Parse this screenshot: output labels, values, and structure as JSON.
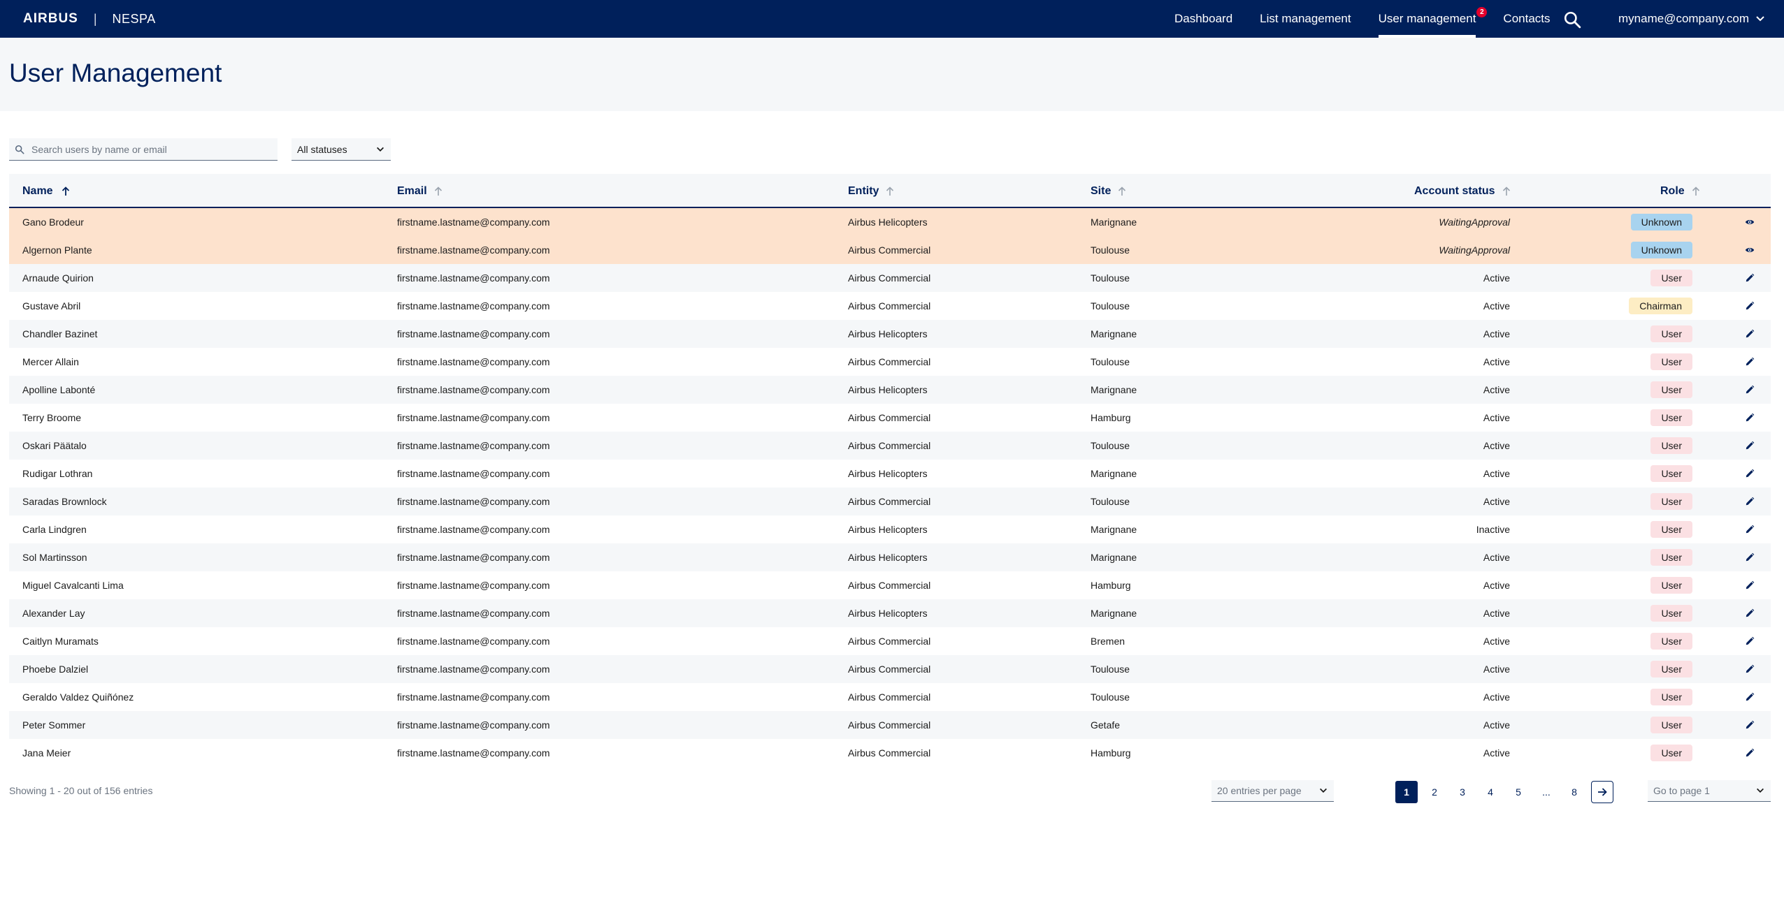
{
  "brand": {
    "logo": "AIRBUS",
    "separator": "|",
    "app_name": "NESPA"
  },
  "nav": {
    "items": [
      {
        "label": "Dashboard",
        "active": false
      },
      {
        "label": "List management",
        "active": false
      },
      {
        "label": "User management",
        "active": true,
        "badge": "2"
      },
      {
        "label": "Contacts",
        "active": false
      }
    ],
    "search_icon": "search-icon",
    "user_email": "myname@company.com"
  },
  "page": {
    "title": "User Management"
  },
  "filters": {
    "search_placeholder": "Search users by name or email",
    "status_value": "All statuses"
  },
  "table": {
    "columns": [
      "Name",
      "Email",
      "Entity",
      "Site",
      "Account status",
      "Role"
    ],
    "rows": [
      {
        "name": "Gano Brodeur",
        "email": "firstname.lastname@company.com",
        "entity": "Airbus Helicopters",
        "site": "Marignane",
        "status": "WaitingApproval",
        "role": "Unknown",
        "action": "eye-icon"
      },
      {
        "name": "Algernon Plante",
        "email": "firstname.lastname@company.com",
        "entity": "Airbus Commercial",
        "site": "Toulouse",
        "status": "WaitingApproval",
        "role": "Unknown",
        "action": "eye-icon"
      },
      {
        "name": "Arnaude Quirion",
        "email": "firstname.lastname@company.com",
        "entity": "Airbus Commercial",
        "site": "Toulouse",
        "status": "Active",
        "role": "User",
        "action": "pencil-icon"
      },
      {
        "name": "Gustave Abril",
        "email": "firstname.lastname@company.com",
        "entity": "Airbus Commercial",
        "site": "Toulouse",
        "status": "Active",
        "role": "Chairman",
        "action": "pencil-icon"
      },
      {
        "name": "Chandler Bazinet",
        "email": "firstname.lastname@company.com",
        "entity": "Airbus Helicopters",
        "site": "Marignane",
        "status": "Active",
        "role": "User",
        "action": "pencil-icon"
      },
      {
        "name": "Mercer Allain",
        "email": "firstname.lastname@company.com",
        "entity": "Airbus Commercial",
        "site": "Toulouse",
        "status": "Active",
        "role": "User",
        "action": "pencil-icon"
      },
      {
        "name": "Apolline Labonté",
        "email": "firstname.lastname@company.com",
        "entity": "Airbus Helicopters",
        "site": "Marignane",
        "status": "Active",
        "role": "User",
        "action": "pencil-icon"
      },
      {
        "name": "Terry Broome",
        "email": "firstname.lastname@company.com",
        "entity": "Airbus Commercial",
        "site": "Hamburg",
        "status": "Active",
        "role": "User",
        "action": "pencil-icon"
      },
      {
        "name": "Oskari Päätalo",
        "email": "firstname.lastname@company.com",
        "entity": "Airbus Commercial",
        "site": "Toulouse",
        "status": "Active",
        "role": "User",
        "action": "pencil-icon"
      },
      {
        "name": "Rudigar Lothran",
        "email": "firstname.lastname@company.com",
        "entity": "Airbus Helicopters",
        "site": "Marignane",
        "status": "Active",
        "role": "User",
        "action": "pencil-icon"
      },
      {
        "name": "Saradas Brownlock",
        "email": "firstname.lastname@company.com",
        "entity": "Airbus Commercial",
        "site": "Toulouse",
        "status": "Active",
        "role": "User",
        "action": "pencil-icon"
      },
      {
        "name": "Carla Lindgren",
        "email": "firstname.lastname@company.com",
        "entity": "Airbus Helicopters",
        "site": "Marignane",
        "status": "Inactive",
        "role": "User",
        "action": "pencil-icon"
      },
      {
        "name": "Sol Martinsson",
        "email": "firstname.lastname@company.com",
        "entity": "Airbus Helicopters",
        "site": "Marignane",
        "status": "Active",
        "role": "User",
        "action": "pencil-icon"
      },
      {
        "name": "Miguel Cavalcanti Lima",
        "email": "firstname.lastname@company.com",
        "entity": "Airbus Commercial",
        "site": "Hamburg",
        "status": "Active",
        "role": "User",
        "action": "pencil-icon"
      },
      {
        "name": "Alexander Lay",
        "email": "firstname.lastname@company.com",
        "entity": "Airbus Helicopters",
        "site": "Marignane",
        "status": "Active",
        "role": "User",
        "action": "pencil-icon"
      },
      {
        "name": "Caitlyn Muramats",
        "email": "firstname.lastname@company.com",
        "entity": "Airbus Commercial",
        "site": "Bremen",
        "status": "Active",
        "role": "User",
        "action": "pencil-icon"
      },
      {
        "name": "Phoebe Dalziel",
        "email": "firstname.lastname@company.com",
        "entity": "Airbus Commercial",
        "site": "Toulouse",
        "status": "Active",
        "role": "User",
        "action": "pencil-icon"
      },
      {
        "name": "Geraldo Valdez Quiñónez",
        "email": "firstname.lastname@company.com",
        "entity": "Airbus Commercial",
        "site": "Toulouse",
        "status": "Active",
        "role": "User",
        "action": "pencil-icon"
      },
      {
        "name": "Peter Sommer",
        "email": "firstname.lastname@company.com",
        "entity": "Airbus Commercial",
        "site": "Getafe",
        "status": "Active",
        "role": "User",
        "action": "pencil-icon"
      },
      {
        "name": "Jana Meier",
        "email": "firstname.lastname@company.com",
        "entity": "Airbus Commercial",
        "site": "Hamburg",
        "status": "Active",
        "role": "User",
        "action": "pencil-icon"
      }
    ]
  },
  "footer": {
    "showing": "Showing 1 - 20 out of 156 entries",
    "per_page": "20 entries per page",
    "pages": [
      "1",
      "2",
      "3",
      "4",
      "5",
      "...",
      "8"
    ],
    "current_page": "1",
    "next_icon": "arrow-right-icon",
    "goto_placeholder": "Go to page 1"
  },
  "colors": {
    "primary": "#00205b",
    "header_bg": "#f5f7f9",
    "pending_row": "#fde2cd",
    "pill_user": "#fbe0e3",
    "pill_chairman": "#fdedc4",
    "pill_unknown": "#a8d3ef",
    "badge": "#e4002b"
  }
}
